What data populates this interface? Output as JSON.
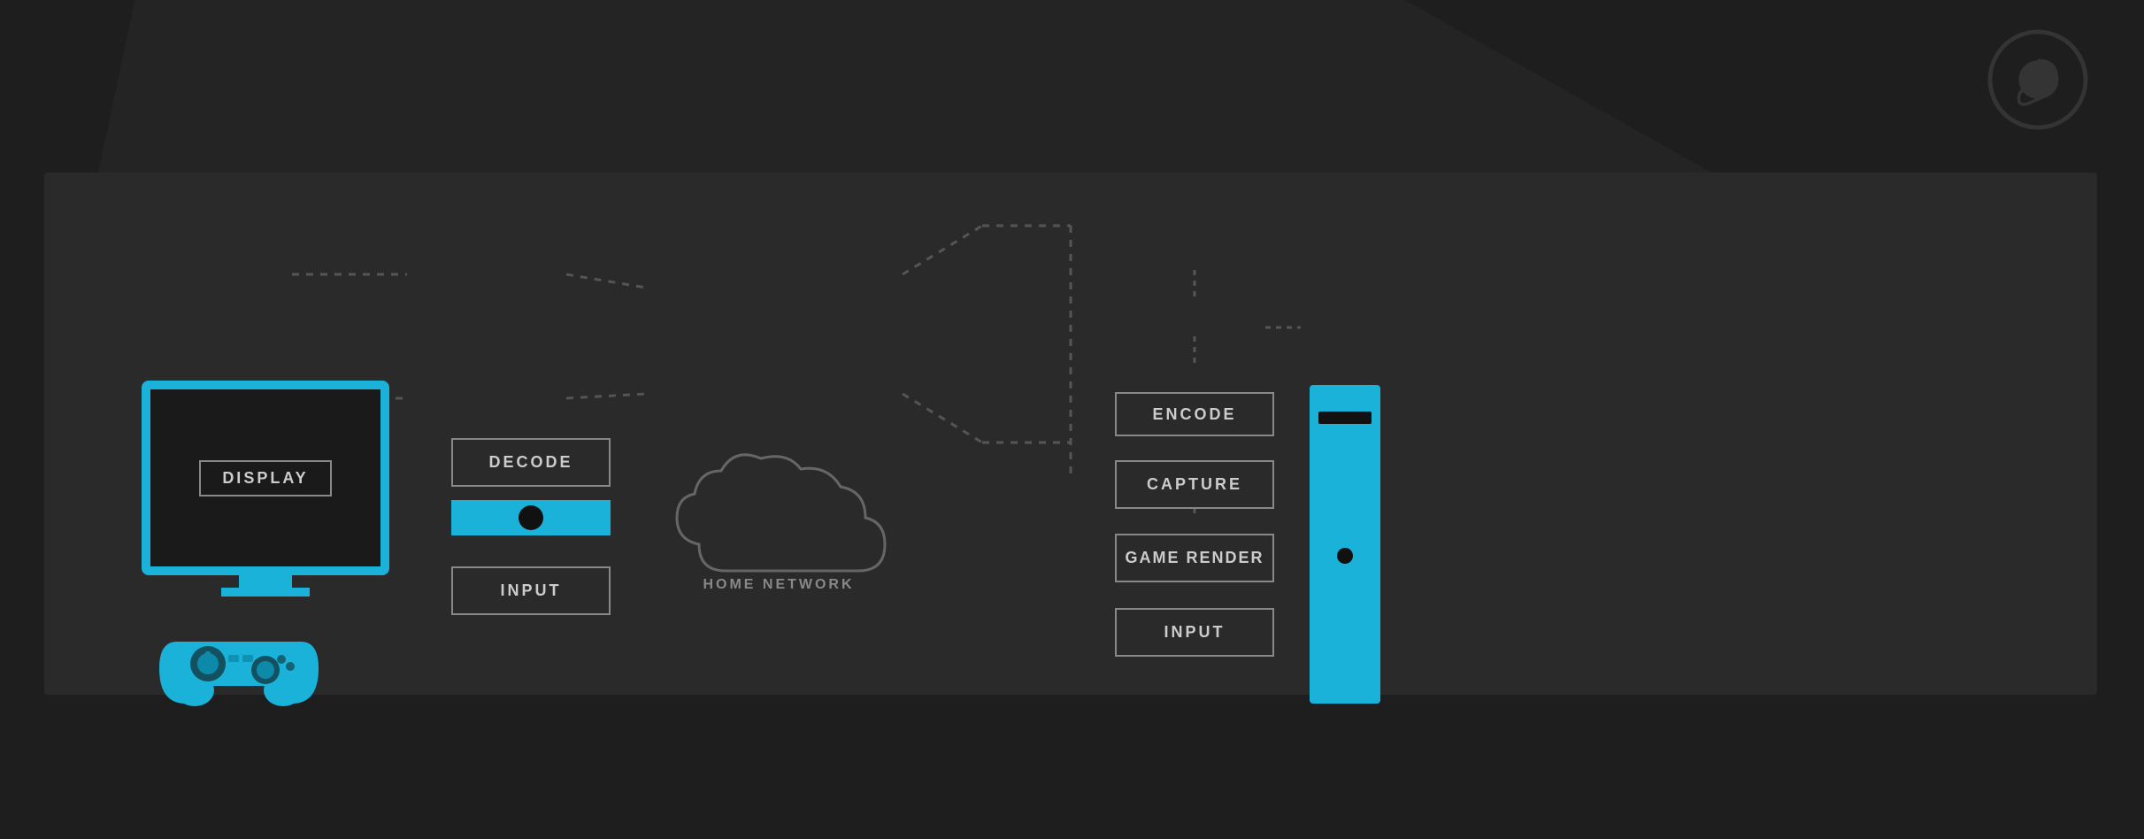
{
  "background": {
    "color": "#1e1e1e",
    "panel_color": "#2a2a2a"
  },
  "steam_logo": {
    "label": "Steam Logo",
    "opacity": 0.4
  },
  "left_side": {
    "tv": {
      "label": "DISPLAY"
    },
    "decode": {
      "label": "DECODE"
    },
    "input": {
      "label": "INPUT"
    }
  },
  "center": {
    "cloud_label": "HOME NETWORK"
  },
  "right_side": {
    "encode": {
      "label": "ENCODE"
    },
    "capture": {
      "label": "CAPTURE"
    },
    "game_render": {
      "label": "GAME RENDER"
    },
    "input": {
      "label": "INPUT"
    }
  },
  "colors": {
    "cyan": "#1ab2d8",
    "border": "#888888",
    "text": "#cccccc",
    "bg_dark": "#1a1a1a",
    "dotted": "#555555"
  }
}
